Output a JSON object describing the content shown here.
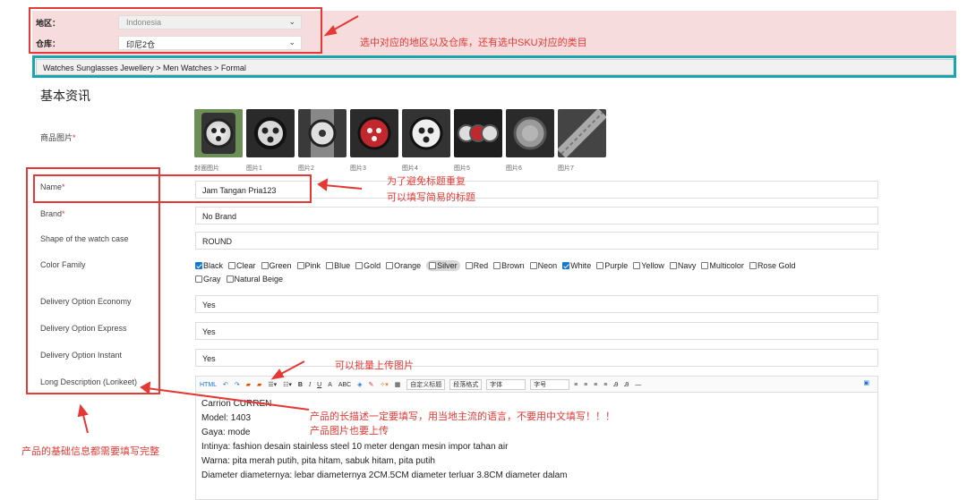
{
  "region": {
    "label": "地区：",
    "value": "Indonesia"
  },
  "warehouse": {
    "label": "仓库：",
    "value": "印尼2仓"
  },
  "breadcrumb": "Watches Sunglasses Jewellery > Men Watches > Formal",
  "section_title": "基本资讯",
  "images": {
    "label": "商品图片",
    "req": "*",
    "captions": [
      "封面图片",
      "图片1",
      "图片2",
      "图片3",
      "图片4",
      "图片5",
      "图片6",
      "图片7"
    ]
  },
  "fields": {
    "name": {
      "label": "Name",
      "req": "*",
      "value": "Jam Tangan Pria123"
    },
    "brand": {
      "label": "Brand",
      "req": "*",
      "value": "No Brand"
    },
    "shape": {
      "label": "Shape of the watch case",
      "value": "ROUND"
    },
    "color_family": {
      "label": "Color Family"
    },
    "delivery_economy": {
      "label": "Delivery Option Economy",
      "value": "Yes"
    },
    "delivery_express": {
      "label": "Delivery Option Express",
      "value": "Yes"
    },
    "delivery_instant": {
      "label": "Delivery Option Instant",
      "value": "Yes"
    },
    "long_desc": {
      "label": "Long Description (Lorikeet)"
    }
  },
  "colors_row1": [
    {
      "label": "Black",
      "checked": true
    },
    {
      "label": "Clear",
      "checked": false
    },
    {
      "label": "Green",
      "checked": false
    },
    {
      "label": "Pink",
      "checked": false
    },
    {
      "label": "Blue",
      "checked": false
    },
    {
      "label": "Gold",
      "checked": false
    },
    {
      "label": "Orange",
      "checked": false
    },
    {
      "label": "Silver",
      "checked": false,
      "highlight": true
    },
    {
      "label": "Red",
      "checked": false
    },
    {
      "label": "Brown",
      "checked": false
    },
    {
      "label": "Neon",
      "checked": false
    },
    {
      "label": "White",
      "checked": true
    },
    {
      "label": "Purple",
      "checked": false
    },
    {
      "label": "Yellow",
      "checked": false
    },
    {
      "label": "Navy",
      "checked": false
    },
    {
      "label": "Multicolor",
      "checked": false
    },
    {
      "label": "Rose Gold",
      "checked": false
    }
  ],
  "colors_row2": [
    {
      "label": "Gray",
      "checked": false
    },
    {
      "label": "Natural Beige",
      "checked": false
    }
  ],
  "toolbar": {
    "html": "HTML",
    "font_family_select": "自定义标题",
    "paragraph_select": "段落格式",
    "font_select": "字体",
    "size_select": "字号"
  },
  "description_lines": [
    "Carrion CURREN",
    "Model: 1403",
    "Gaya: mode",
    "Intinya: fashion desain stainless steel 10 meter dengan mesin impor tahan air",
    "Warna: pita merah putih, pita hitam, sabuk hitam, pita putih",
    "Diameter diameternya: lebar diameternya 2CM.5CM diameter terluar 3.8CM diameter dalam"
  ],
  "annotations": {
    "select_hint": "选中对应的地区以及仓库，还有选中SKU对应的类目",
    "title_hint_1": "为了避免标题重复",
    "title_hint_2": "可以填写简易的标题",
    "batch_upload": "可以批量上传图片",
    "desc_hint_1": "产品的长描述一定要填写，用当地主流的语言，不要用中文填写！！！",
    "desc_hint_2": "产品图片也要上传",
    "basic_info_hint": "产品的基础信息都需要填写完整"
  },
  "colors": {
    "accent_red": "#e53935",
    "cyan_frame": "#1aa5b0",
    "panel_pink": "#f6dcdc",
    "checkbox_blue": "#1976d2"
  }
}
